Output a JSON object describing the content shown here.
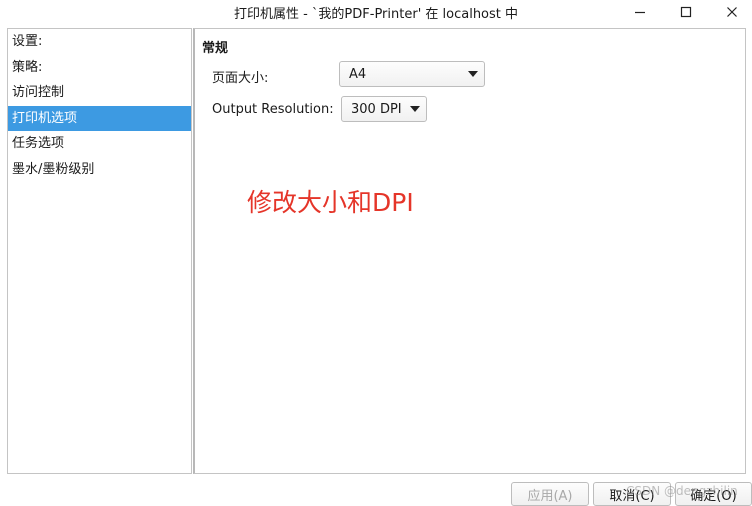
{
  "window": {
    "title": "打印机属性 - `我的PDF-Printer' 在 localhost 中",
    "controls": {
      "minimize_icon": "minimize-icon",
      "maximize_icon": "maximize-icon",
      "close_icon": "close-icon"
    }
  },
  "sidebar": {
    "items": [
      {
        "label": "设置:"
      },
      {
        "label": "策略:"
      },
      {
        "label": "访问控制"
      },
      {
        "label": "打印机选项"
      },
      {
        "label": "任务选项"
      },
      {
        "label": "墨水/墨粉级别"
      }
    ],
    "selected_index": 3,
    "selected_color": "#3d9ae2"
  },
  "content": {
    "section_title": "常规",
    "page_size": {
      "label": "页面大小:",
      "value": "A4"
    },
    "output_resolution": {
      "label": "Output Resolution:",
      "value": "300 DPI"
    },
    "annotation": {
      "text": "修改大小和DPI",
      "color": "#e53529"
    }
  },
  "buttons": {
    "apply": "应用(A)",
    "cancel": "取消(C)",
    "ok": "确定(O)"
  },
  "watermark": "CSDN @dengzhilin"
}
